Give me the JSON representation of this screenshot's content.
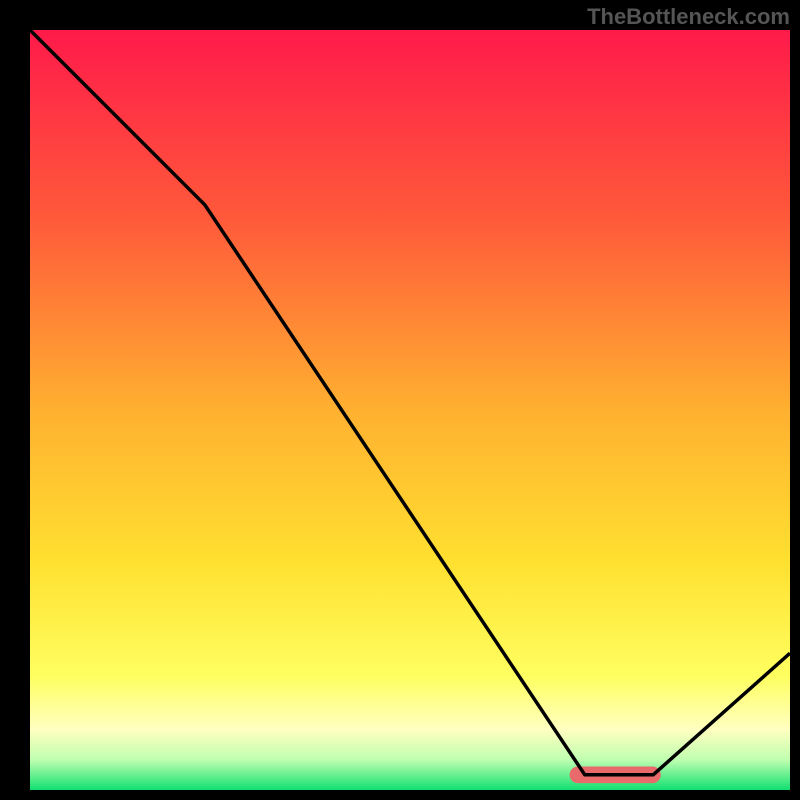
{
  "watermark": "TheBottleneck.com",
  "chart_data": {
    "type": "line",
    "title": "",
    "xlabel": "",
    "ylabel": "",
    "xlim": [
      0,
      100
    ],
    "ylim": [
      0,
      100
    ],
    "background_gradient": {
      "type": "vertical",
      "stops": [
        {
          "offset": 0,
          "color": "#ff1a4a"
        },
        {
          "offset": 25,
          "color": "#ff5a3a"
        },
        {
          "offset": 50,
          "color": "#ffb030"
        },
        {
          "offset": 70,
          "color": "#ffe030"
        },
        {
          "offset": 85,
          "color": "#ffff60"
        },
        {
          "offset": 92,
          "color": "#ffffc0"
        },
        {
          "offset": 96,
          "color": "#c0ffb0"
        },
        {
          "offset": 100,
          "color": "#10e070"
        }
      ]
    },
    "curve": {
      "description": "bottleneck deviation curve (V-shape)",
      "points": [
        {
          "x": 0,
          "y": 100
        },
        {
          "x": 23,
          "y": 77
        },
        {
          "x": 73,
          "y": 2
        },
        {
          "x": 82,
          "y": 2
        },
        {
          "x": 100,
          "y": 18
        }
      ]
    },
    "optimal_marker": {
      "x_start": 71,
      "x_end": 83,
      "y": 2,
      "color": "#e86a6a",
      "height": 2.2
    }
  }
}
